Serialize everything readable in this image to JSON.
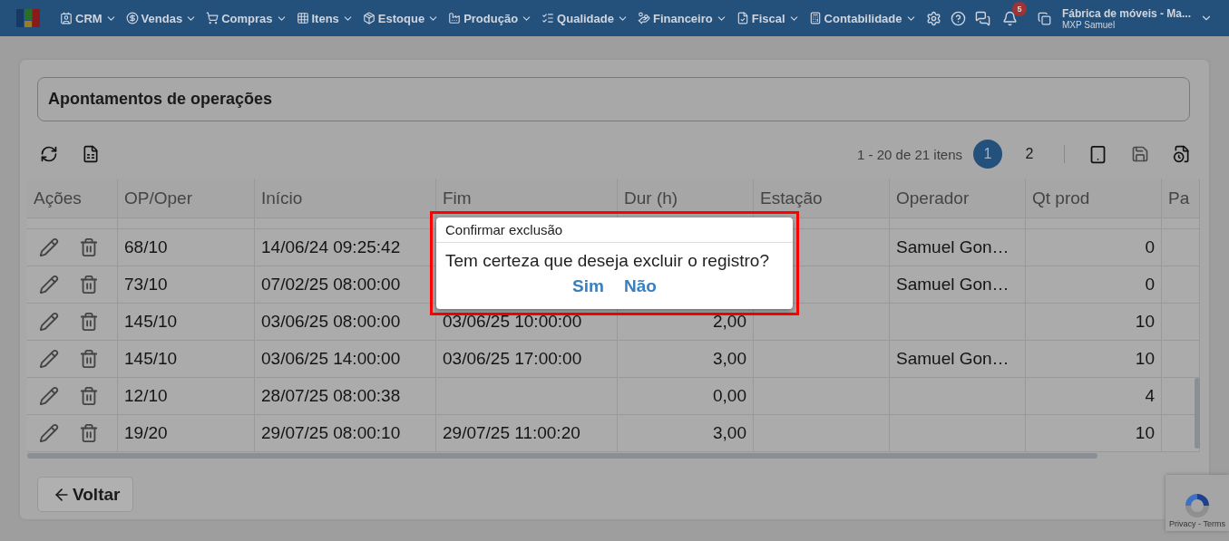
{
  "navbar": {
    "menus": [
      {
        "kind": "crm",
        "label": "CRM"
      },
      {
        "kind": "sales",
        "label": "Vendas"
      },
      {
        "kind": "purchases",
        "label": "Compras"
      },
      {
        "kind": "items",
        "label": "Itens"
      },
      {
        "kind": "stock",
        "label": "Estoque"
      },
      {
        "kind": "production",
        "label": "Produção"
      },
      {
        "kind": "quality",
        "label": "Qualidade"
      },
      {
        "kind": "finance",
        "label": "Financeiro"
      },
      {
        "kind": "fiscal",
        "label": "Fiscal"
      },
      {
        "kind": "accounting",
        "label": "Contabilidade"
      }
    ],
    "notification_count": "5",
    "company": "Fábrica de móveis - Ma...",
    "user": "MXP Samuel"
  },
  "page_title": "Apontamentos de operações",
  "pager": {
    "summary": "1 - 20 de 21 itens",
    "pages": [
      {
        "label": "1",
        "selected": true
      },
      {
        "label": "2",
        "selected": false
      }
    ]
  },
  "table": {
    "columns": [
      "Ações",
      "OP/Oper",
      "Início",
      "Fim",
      "Dur (h)",
      "Estação",
      "Operador",
      "Qt prod",
      "Pa"
    ],
    "rows": [
      {
        "cells": [
          null,
          "68/10",
          "14/06/24 09:25:42",
          null,
          null,
          null,
          "Samuel Gon…",
          "0",
          null
        ]
      },
      {
        "cells": [
          null,
          "73/10",
          "07/02/25 08:00:00",
          null,
          null,
          null,
          "Samuel Gon…",
          "0",
          null
        ]
      },
      {
        "cells": [
          null,
          "145/10",
          "03/06/25 08:00:00",
          "03/06/25 10:00:00",
          "2,00",
          null,
          null,
          "10",
          null
        ]
      },
      {
        "cells": [
          null,
          "145/10",
          "03/06/25 14:00:00",
          "03/06/25 17:00:00",
          "3,00",
          null,
          "Samuel Gon…",
          "10",
          null
        ]
      },
      {
        "cells": [
          null,
          "12/10",
          "28/07/25 08:00:38",
          null,
          "0,00",
          null,
          null,
          "4",
          null
        ]
      },
      {
        "cells": [
          null,
          "19/20",
          "29/07/25 08:00:10",
          "29/07/25 11:00:20",
          "3,00",
          null,
          null,
          "10",
          null
        ]
      }
    ]
  },
  "back_button": "Voltar",
  "dialog": {
    "title": "Confirmar exclusão",
    "message": "Tem certeza que deseja excluir o registro?",
    "buttons": [
      "Sim",
      "Não"
    ]
  },
  "recaptcha": "Privacy - Terms"
}
